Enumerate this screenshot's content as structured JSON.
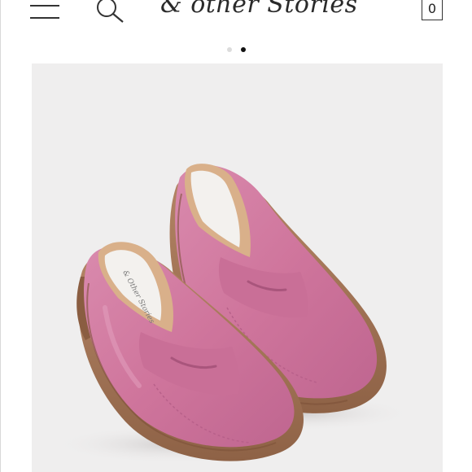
{
  "header": {
    "menu_icon": "hamburger-menu-icon",
    "search_icon": "search-icon",
    "logo_text": "& other Stories",
    "cart_icon": "shopping-bag-icon",
    "cart_count": "0"
  },
  "carousel": {
    "total_slides": 2,
    "active_slide": 2
  },
  "product_image": {
    "subject": "pink suede penny loafers",
    "insole_text": "& Other Stories",
    "colors": {
      "background": "#efeeee",
      "suede": "#d07a9e",
      "sole": "#a8785a",
      "lining": "#d9b08a"
    }
  }
}
